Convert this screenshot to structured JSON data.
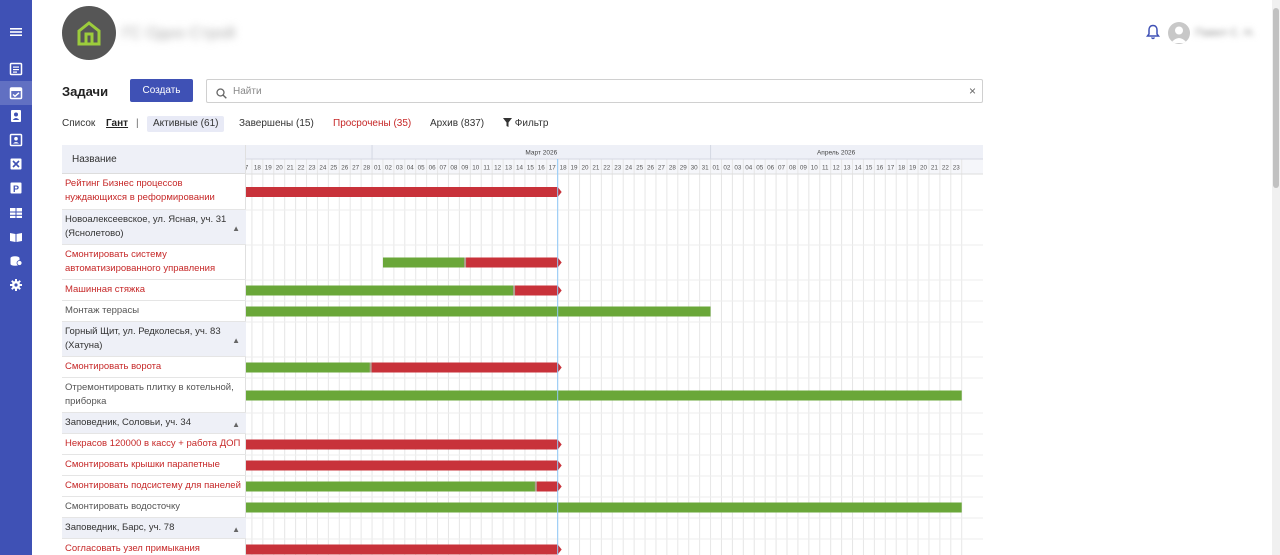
{
  "app": {
    "company_name": "ГС Одно Строй",
    "user_name": "Павел С. Н."
  },
  "page": {
    "title": "Задачи",
    "create_button": "Создать",
    "search_placeholder": "Найти",
    "clear_icon": "×"
  },
  "tabs": {
    "list": "Список",
    "gantt": "Гант",
    "separator": "|",
    "active": "Активные (61)",
    "done": "Завершены (15)",
    "overdue": "Просрочены (35)",
    "archive": "Архив (837)",
    "filter": "Фильтр"
  },
  "gantt": {
    "name_header": "Название",
    "months": [
      {
        "label": "Март 2026"
      },
      {
        "label": "Апрель 2026"
      }
    ],
    "days": [
      "7",
      "18",
      "19",
      "20",
      "21",
      "22",
      "23",
      "24",
      "25",
      "26",
      "27",
      "28",
      "01",
      "02",
      "03",
      "04",
      "05",
      "06",
      "07",
      "08",
      "09",
      "10",
      "11",
      "12",
      "13",
      "14",
      "15",
      "16",
      "17",
      "18",
      "19",
      "20",
      "21",
      "22",
      "23",
      "24",
      "25",
      "26",
      "27",
      "28",
      "29",
      "30",
      "31",
      "01",
      "02",
      "03",
      "04",
      "05",
      "06",
      "07",
      "08",
      "09",
      "10",
      "11",
      "12",
      "13",
      "14",
      "15",
      "16",
      "17",
      "18",
      "19",
      "20",
      "21",
      "22",
      "23"
    ],
    "today_day": "17",
    "colors": {
      "done": "#6aa739",
      "overdue": "#c8323a",
      "today_line": "#90caf9"
    },
    "rows": [
      {
        "name": "Рейтинг Бизнес процессов нуждающихся в реформировании",
        "kind": "task",
        "status": "overdue",
        "start": "2026-02-17",
        "end": "2026-03-17",
        "progress": 0
      },
      {
        "name": "Новоалексеевское, ул. Ясная, уч. 31 (Яснолетово)",
        "kind": "group"
      },
      {
        "name": "Смонтировать систему автоматизированного управления",
        "kind": "task",
        "status": "overdue",
        "start": "2026-03-02",
        "end": "2026-03-17",
        "progress": 0.47
      },
      {
        "name": "Машинная стяжка",
        "kind": "task",
        "status": "overdue",
        "start": "2026-02-17",
        "end": "2026-03-17",
        "progress": 0.86
      },
      {
        "name": "Монтаж террасы",
        "kind": "task",
        "status": "active",
        "start": "2026-02-17",
        "end": "2026-03-31",
        "progress": 1
      },
      {
        "name": "Горный Щит, ул. Редколесья, уч. 83 (Хатуна)",
        "kind": "group"
      },
      {
        "name": "Смонтировать ворота",
        "kind": "task",
        "status": "overdue",
        "start": "2026-02-17",
        "end": "2026-03-17",
        "progress": 0.4
      },
      {
        "name": "Отремонтировать плитку в котельной, приборка",
        "kind": "task",
        "status": "active",
        "start": "2026-02-17",
        "end": "2026-04-23",
        "progress": 1
      },
      {
        "name": "Заповедник, Соловьи, уч. 34",
        "kind": "group"
      },
      {
        "name": "Некрасов 120000 в кассу + работа ДОП",
        "kind": "task",
        "status": "overdue",
        "start": "2026-02-17",
        "end": "2026-03-17",
        "progress": 0
      },
      {
        "name": "Смонтировать крышки парапетные",
        "kind": "task",
        "status": "overdue",
        "start": "2026-02-17",
        "end": "2026-03-17",
        "progress": 0
      },
      {
        "name": "Смонтировать подсистему для панелей",
        "kind": "task",
        "status": "overdue",
        "start": "2026-02-17",
        "end": "2026-03-17",
        "progress": 0.93
      },
      {
        "name": "Смонтировать водосточку",
        "kind": "task",
        "status": "active",
        "start": "2026-02-17",
        "end": "2026-04-23",
        "progress": 1
      },
      {
        "name": "Заповедник, Барс, уч. 78",
        "kind": "group"
      },
      {
        "name": "Согласовать узел примыкания",
        "kind": "task",
        "status": "overdue",
        "start": "2026-02-17",
        "end": "2026-03-17",
        "progress": 0
      }
    ]
  }
}
